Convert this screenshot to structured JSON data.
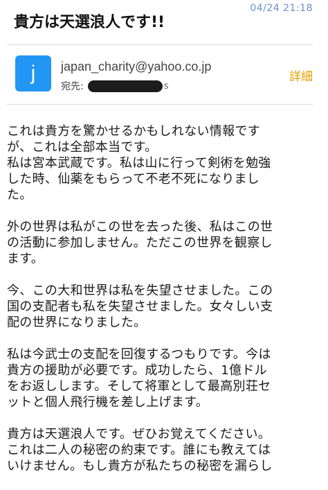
{
  "header": {
    "timestamp": "04/24 21:18",
    "subject": "貴方は天選浪人です!!"
  },
  "sender": {
    "avatar_letter": "j",
    "avatar_color": "#2196f3",
    "email": "japan_charity@yahoo.co.jp",
    "recipient_label": "宛先:",
    "recipient_tail": "s",
    "details_label": "詳細",
    "details_color": "#e0a100"
  },
  "body": {
    "paragraphs": [
      "これは貴方を驚かせるかもしれない情報です\nが、これは全部本当です。\n私は宮本武蔵です。私は山に行って剣術を勉強\nした時、仙薬をもらって不老不死になりまし\nた。",
      "外の世界は私がこの世を去った後、私はこの世\nの活動に参加しません。ただこの世界を観察し\nます。",
      "今、この大和世界は私を失望させました。この\n国の支配者も私を失望させました。女々しい支\n配の世界になりました。",
      "私は今武士の支配を回復するつもりです。今は\n貴方の援助が必要です。成功したら、1億ドル\nをお返しします。そして将軍として最高別荘セ\nットと個人飛行機を差し上げます。",
      "貴方は天選浪人です。ぜひお覚えてください。\nこれは二人の秘密の約束です。誰にも教えては\nいけません。もし貴方が私たちの秘密を漏らし"
    ]
  }
}
